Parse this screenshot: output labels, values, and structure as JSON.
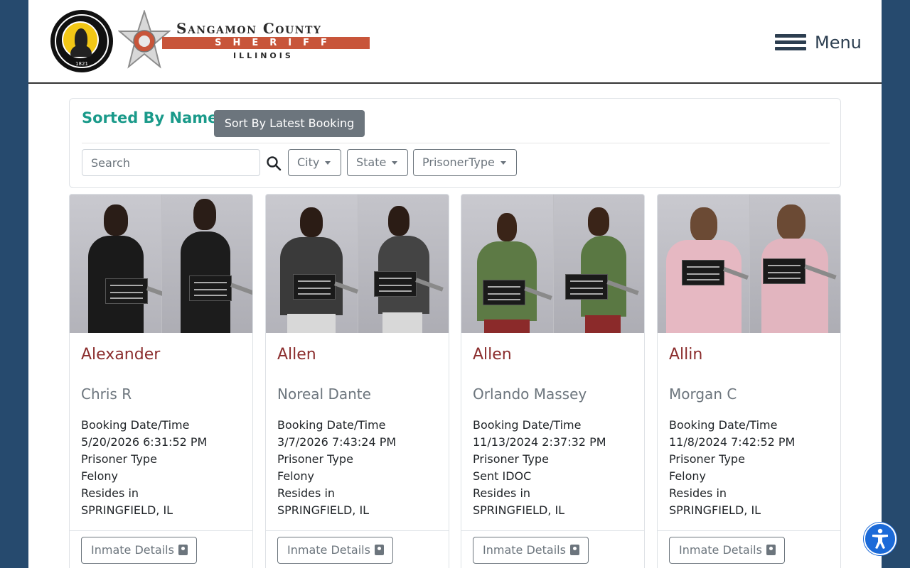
{
  "header": {
    "seal_year": "1821",
    "brand_title": "Sangamon County",
    "brand_bar": "SHERIFF",
    "brand_sub": "ILLINOIS",
    "menu_label": "Menu"
  },
  "filters": {
    "sorted_title": "Sorted By Name",
    "sort_button": "Sort By Latest Booking",
    "search_placeholder": "Search",
    "city_label": "City",
    "state_label": "State",
    "type_label": "PrisonerType"
  },
  "cards": [
    {
      "last_name": "Alexander",
      "first_name": "Chris R",
      "booking_label": "Booking Date/Time",
      "booking_value": "5/20/2026 6:31:52 PM",
      "type_label": "Prisoner Type",
      "type_value": "Felony",
      "resides_label": "Resides in",
      "resides_value": "SPRINGFIELD, IL",
      "button": "Inmate Details"
    },
    {
      "last_name": "Allen",
      "first_name": "Noreal Dante",
      "booking_label": "Booking Date/Time",
      "booking_value": "3/7/2026 7:43:24 PM",
      "type_label": "Prisoner Type",
      "type_value": "Felony",
      "resides_label": "Resides in",
      "resides_value": "SPRINGFIELD, IL",
      "button": "Inmate Details"
    },
    {
      "last_name": "Allen",
      "first_name": "Orlando Massey",
      "booking_label": "Booking Date/Time",
      "booking_value": "11/13/2024 2:37:32 PM",
      "type_label": "Prisoner Type",
      "type_value": "Sent IDOC",
      "resides_label": "Resides in",
      "resides_value": "SPRINGFIELD, IL",
      "button": "Inmate Details"
    },
    {
      "last_name": "Allin",
      "first_name": "Morgan C",
      "booking_label": "Booking Date/Time",
      "booking_value": "11/8/2024 7:42:52 PM",
      "type_label": "Prisoner Type",
      "type_value": "Felony",
      "resides_label": "Resides in",
      "resides_value": "SPRINGFIELD, IL",
      "button": "Inmate Details"
    }
  ]
}
